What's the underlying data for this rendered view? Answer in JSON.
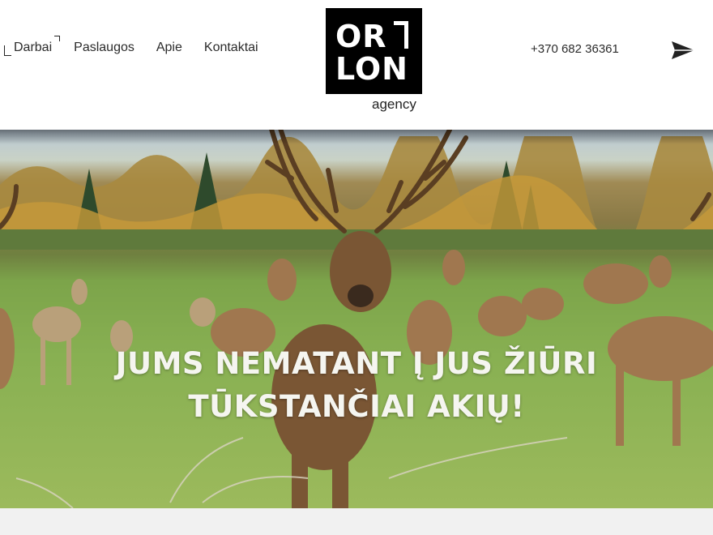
{
  "nav": {
    "items": [
      {
        "label": "Darbai",
        "active": true
      },
      {
        "label": "Paslaugos"
      },
      {
        "label": "Apie"
      },
      {
        "label": "Kontaktai"
      }
    ]
  },
  "logo": {
    "line1": "OR",
    "line2": "LON",
    "tagline": "agency"
  },
  "contact": {
    "phone": "+370 682 36361"
  },
  "icons": {
    "send": "send-icon"
  },
  "hero": {
    "line1": "JUMS NEMATANT Į JUS ŽIŪRI",
    "line2": "TŪKSTANČIAI AKIŲ!"
  },
  "colors": {
    "logo_bg": "#000000",
    "text": "#2b2b2b",
    "headline": "#f5f5f0"
  }
}
